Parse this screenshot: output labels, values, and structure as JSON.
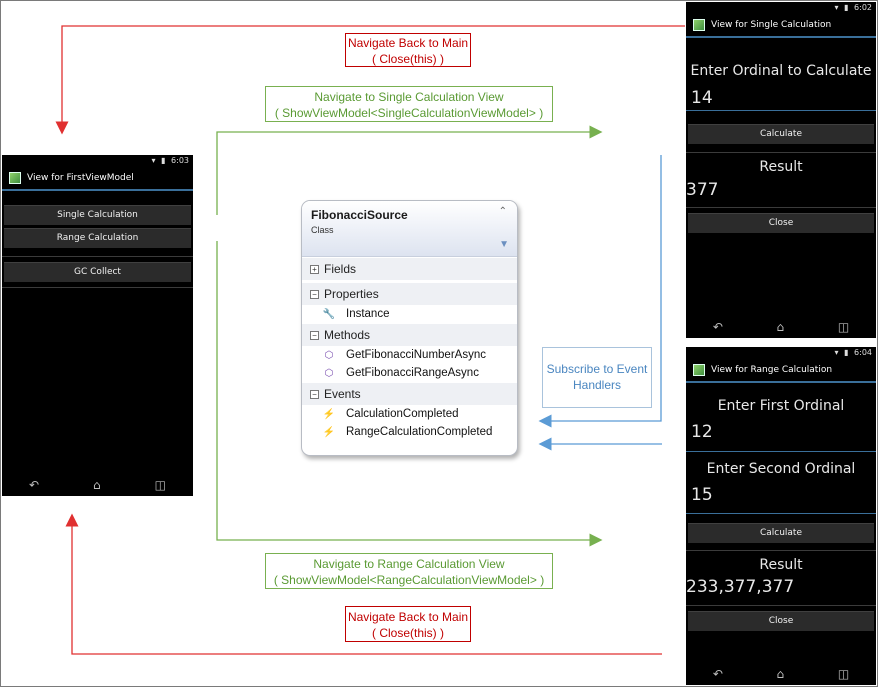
{
  "labels": {
    "navigate_back_top": [
      "Navigate Back to Main",
      "( Close(this) )"
    ],
    "navigate_single": [
      "Navigate to Single Calculation View",
      "( ShowViewModel<SingleCalculationViewModel> )"
    ],
    "subscribe": "Subscribe to Event Handlers",
    "navigate_range": [
      "Navigate to Range Calculation View",
      "( ShowViewModel<RangeCalculationViewModel> )"
    ],
    "navigate_back_bottom": [
      "Navigate Back to Main",
      "( Close(this) )"
    ]
  },
  "first_view": {
    "time": "6:03",
    "title": "View for FirstViewModel",
    "buttons": [
      "Single Calculation",
      "Range Calculation",
      "GC Collect"
    ]
  },
  "single_view": {
    "time": "6:02",
    "title": "View for Single Calculation",
    "prompt": "Enter Ordinal to Calculate",
    "input_value": "14",
    "calculate_label": "Calculate",
    "result_label": "Result",
    "result_value": "377",
    "close_label": "Close"
  },
  "range_view": {
    "time": "6:04",
    "title": "View for Range Calculation",
    "first_prompt": "Enter First Ordinal",
    "first_value": "12",
    "second_prompt": "Enter Second Ordinal",
    "second_value": "15",
    "calculate_label": "Calculate",
    "result_label": "Result",
    "result_value": "233,377,377",
    "close_label": "Close"
  },
  "class_card": {
    "name": "FibonacciSource",
    "kind": "Class",
    "sections": {
      "fields": "Fields",
      "properties": "Properties",
      "methods": "Methods",
      "events": "Events"
    },
    "properties": [
      "Instance"
    ],
    "methods": [
      "GetFibonacciNumberAsync",
      "GetFibonacciRangeAsync"
    ],
    "events": [
      "CalculationCompleted",
      "RangeCalculationCompleted"
    ]
  },
  "colors": {
    "back_arrow": "#e03030",
    "navigate_arrow": "#77b04f",
    "subscribe_arrow": "#5b9bd5"
  }
}
